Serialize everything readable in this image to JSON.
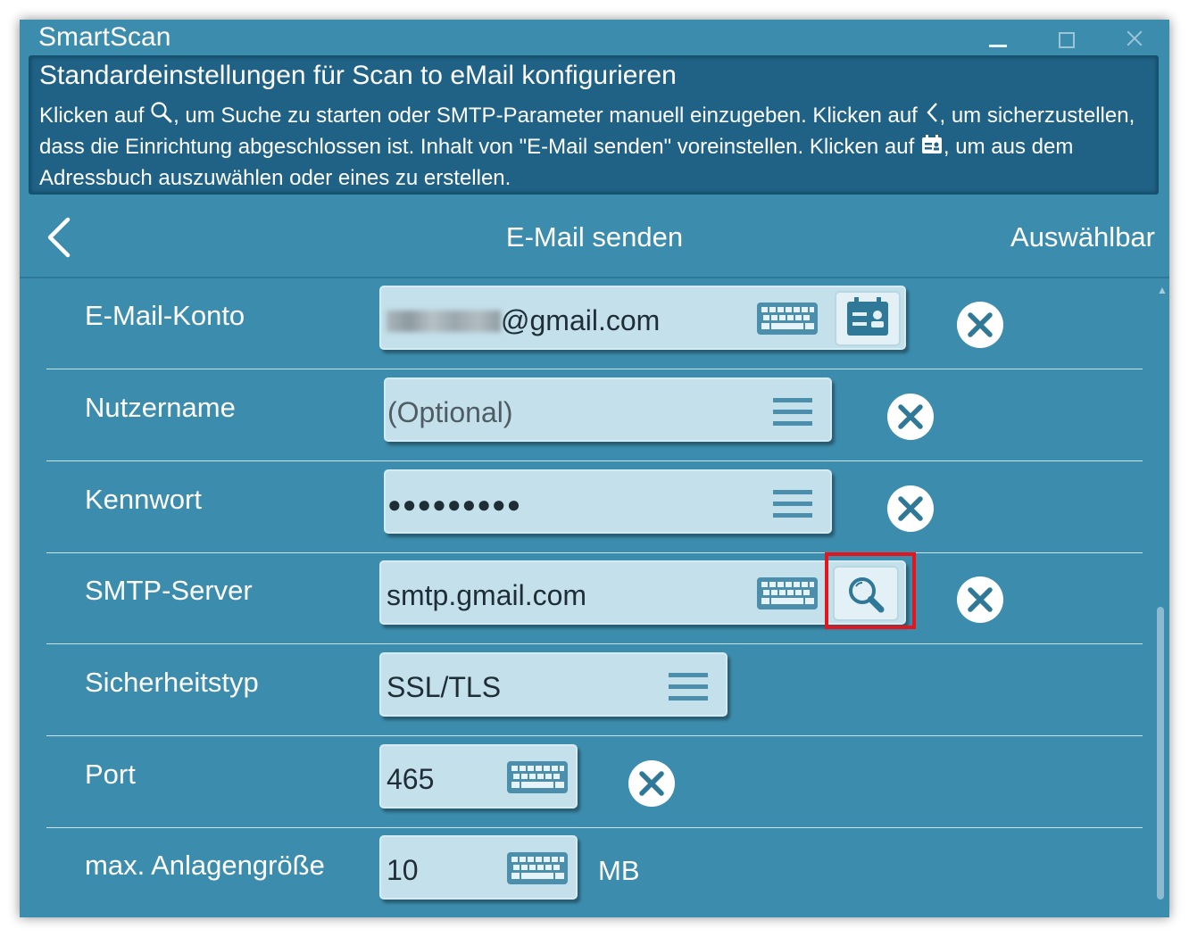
{
  "app": {
    "title": "SmartScan"
  },
  "info": {
    "title": "Standardeinstellungen für Scan to eMail konfigurieren",
    "text_part1": "Klicken auf ",
    "text_part2": ", um Suche zu starten oder SMTP-Parameter manuell einzugeben. Klicken auf ",
    "text_part3": ", um sicherzustellen, dass die Einrichtung abgeschlossen ist. Inhalt von \"E-Mail senden\" voreinstellen. Klicken auf ",
    "text_part4": ", um aus dem Adressbuch auszuwählen oder eines zu erstellen."
  },
  "nav": {
    "title": "E-Mail senden",
    "right_label": "Auswählbar"
  },
  "form": {
    "email_account": {
      "label": "E-Mail-Konto",
      "value_suffix": "@gmail.com"
    },
    "username": {
      "label": "Nutzername",
      "placeholder": "(Optional)"
    },
    "password": {
      "label": "Kennwort",
      "value": "●●●●●●●●●"
    },
    "smtp_server": {
      "label": "SMTP-Server",
      "value": "smtp.gmail.com"
    },
    "security_type": {
      "label": "Sicherheitstyp",
      "value": "SSL/TLS"
    },
    "port": {
      "label": "Port",
      "value": "465"
    },
    "max_attachment": {
      "label": "max. Anlagengröße",
      "value": "10",
      "unit": "MB"
    }
  },
  "colors": {
    "background": "#3c8cad",
    "info_panel": "#1f6286",
    "field": "#c4e0ea",
    "highlight": "#e8141c"
  },
  "icons": {
    "search": "search-icon",
    "back": "chevron-left-icon",
    "address_book": "address-book-icon",
    "keyboard": "keyboard-icon",
    "menu": "menu-icon",
    "clear": "close-circle-icon"
  }
}
